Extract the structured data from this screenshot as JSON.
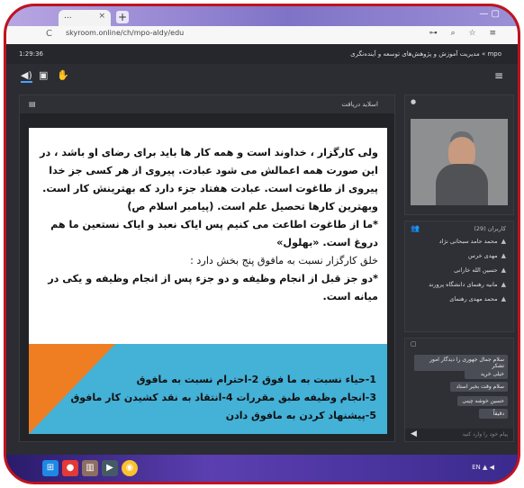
{
  "browser": {
    "tab_title": "...",
    "tab_close": "×",
    "new_tab": "+",
    "nav_glyphs": "C",
    "url": "skyroom.online/ch/mpo-aldy/edu",
    "right_icons": "⊶ ⌕ ☆ ≡"
  },
  "app": {
    "title": "mpo » مدیریت آموزش و پژوهش‌های توسعه و آینده‌نگری",
    "timer": "1:29:36",
    "toolbar_icons": [
      "speaker-icon",
      "screen-icon",
      "hand-icon"
    ],
    "menu_label": "≡"
  },
  "content": {
    "panel_title": "اسلاید دریافت",
    "slide": {
      "lines": [
        "ولی کارگزار ، خداوند است و همه کار ها باید برای رضای او باشد ، در",
        "این صورت همه اعمالش می شود عبادت. پیروی از هر کسی جز خدا",
        "پیروی از طاغوت است. عبادت هفتاد جزء دارد که بهترینش کار است.",
        "وبهترین کارها تحصیل علم است. (پیامبر اسلام ص)",
        "*ما از طاغوت اطاعت می کنیم پس ایاک نعبد و ایاک نستعین ما هم",
        "دروغ است. «بهلول»",
        "خلق کارگزار نسبت به مافوق پنج بخش دارد :",
        "*دو جز قبل از انجام وظیفه و دو جزء پس از انجام وظیفه و یکی در",
        "میانه است."
      ],
      "list": [
        "1-حیاء نسبت به ما فوق        2-احترام نسبت به مافوق",
        "3-انجام وظیفه طبق مقررات     4-انتقاد به نقد کشیدن کار مافوق",
        "5-پیشنهاد کردن به مافوق دادن"
      ]
    }
  },
  "users": {
    "title": "کاربران (29)",
    "list": [
      "محمد حامد سبحانی نژاد",
      "مهدی خرس",
      "حسین الله خارانی",
      "مانیه رهنمای دانشگاه پرورند",
      "محمد مهدی رهنمای"
    ]
  },
  "chat": {
    "messages": [
      "سلام جمال جهوری را دیدگار امور تشکر",
      "خیلی خرید",
      "سلام وقت بخیر استاد",
      "حسین خوشه چینی",
      "دقیقاً"
    ],
    "input_placeholder": "پیام خود را وارد کنید"
  },
  "taskbar": {
    "system_text": "EN ▲ ◀"
  }
}
